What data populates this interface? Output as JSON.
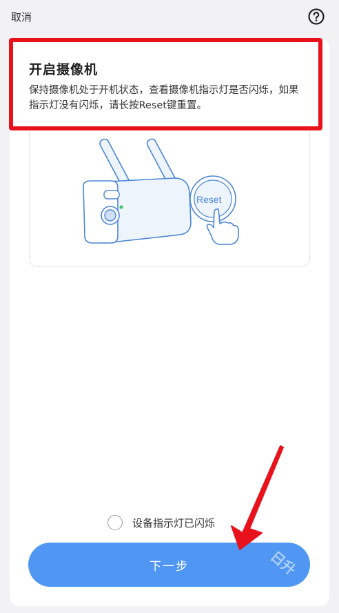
{
  "header": {
    "cancel_label": "取消",
    "help_icon": "question-circle-icon"
  },
  "step": {
    "title": "开启摄像机",
    "description": "保持摄像机处于开机状态，查看摄像机指示灯是否闪烁，如果指示灯没有闪烁，请长按Reset键重置。"
  },
  "illustration": {
    "reset_label": "Reset"
  },
  "confirm": {
    "label": "设备指示灯已闪烁",
    "checked": false
  },
  "footer": {
    "next_label": "下一步"
  },
  "watermark": {
    "text": "日升"
  },
  "colors": {
    "accent": "#4f97f3",
    "annotation_red": "#e8121d",
    "camera_blue": "#4a86d6"
  }
}
